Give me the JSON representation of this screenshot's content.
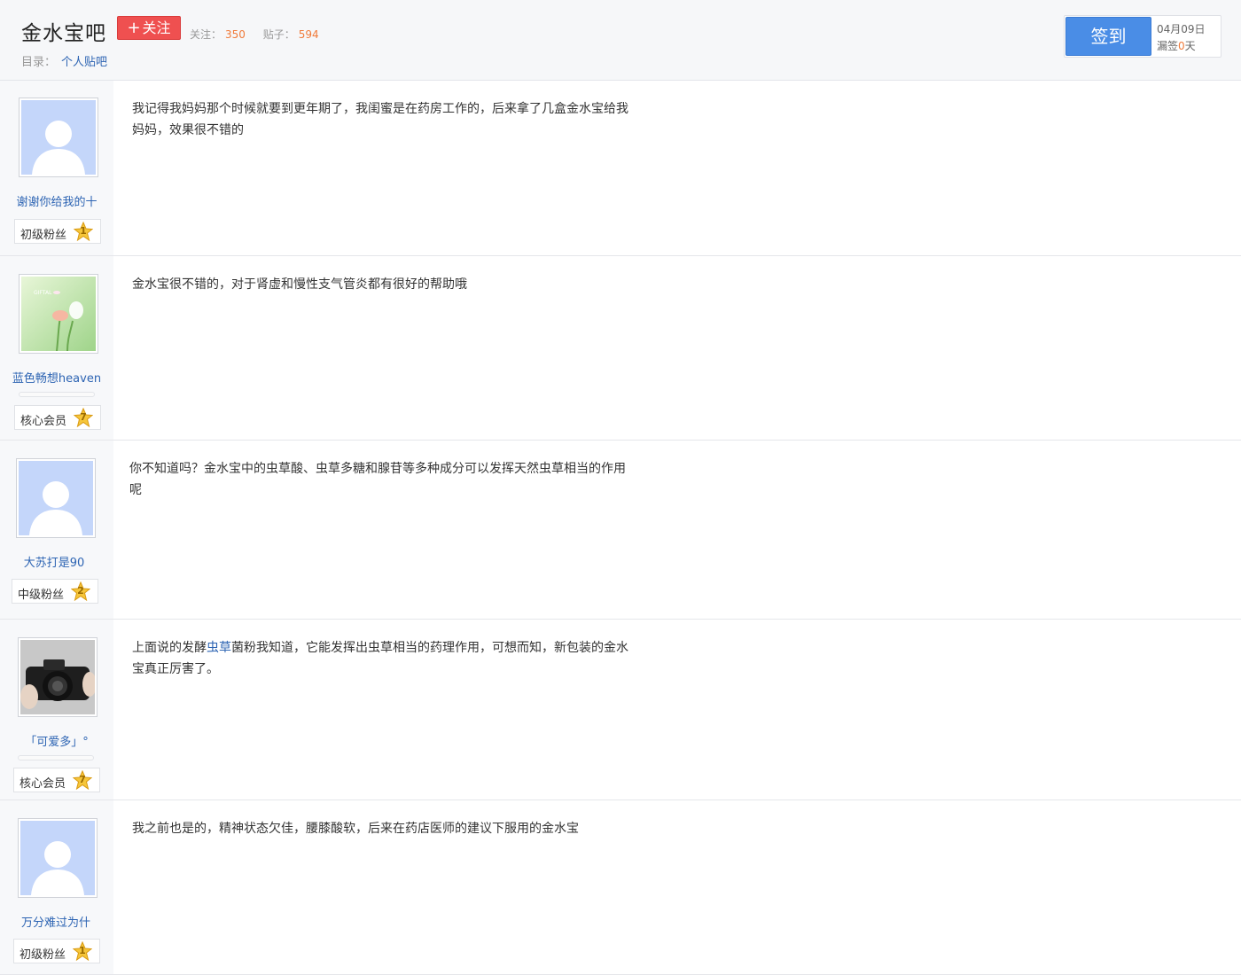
{
  "header": {
    "forum_name": "金水宝吧",
    "follow_label": "关注",
    "follow_icon": "plus-icon",
    "stats": {
      "followers_label": "关注：",
      "followers_value": "350",
      "posts_label": "贴子：",
      "posts_value": "594"
    },
    "directory_label": "目录：",
    "directory_link": "个人贴吧"
  },
  "signin": {
    "button_label": "签到",
    "date": "04月09日",
    "missed_prefix": "漏签",
    "missed_days": "0",
    "missed_suffix": "天"
  },
  "posts": [
    {
      "author": "谢谢你给我的十",
      "avatar": "default-avatar-icon",
      "level_title": "初级粉丝",
      "level": "1",
      "content": "我记得我妈妈那个时候就要到更年期了，我闺蜜是在药房工作的，后来拿了几盒金水宝给我妈妈，效果很不错的"
    },
    {
      "author": "蓝色畅想heaven",
      "avatar": "flower-avatar-icon",
      "level_title": "核心会员",
      "level": "7",
      "content": "金水宝很不错的，对于肾虚和慢性支气管炎都有很好的帮助哦"
    },
    {
      "author": "大苏打是90",
      "avatar": "default-avatar-icon",
      "level_title": "中级粉丝",
      "level": "2",
      "content": "你不知道吗？金水宝中的虫草酸、虫草多糖和腺苷等多种成分可以发挥天然虫草相当的作用呢"
    },
    {
      "author": "「可爱多」°",
      "avatar": "camera-avatar-icon",
      "level_title": "核心会员",
      "level": "7",
      "content_before": "上面说的发酵",
      "content_link": "虫草",
      "content_after": "菌粉我知道，它能发挥出虫草相当的药理作用，可想而知，新包装的金水宝真正厉害了。"
    },
    {
      "author": "万分难过为什",
      "avatar": "default-avatar-icon",
      "level_title": "初级粉丝",
      "level": "1",
      "content": "我之前也是的，精神状态欠佳，腰膝酸软，后来在药店医师的建议下服用的金水宝"
    }
  ]
}
